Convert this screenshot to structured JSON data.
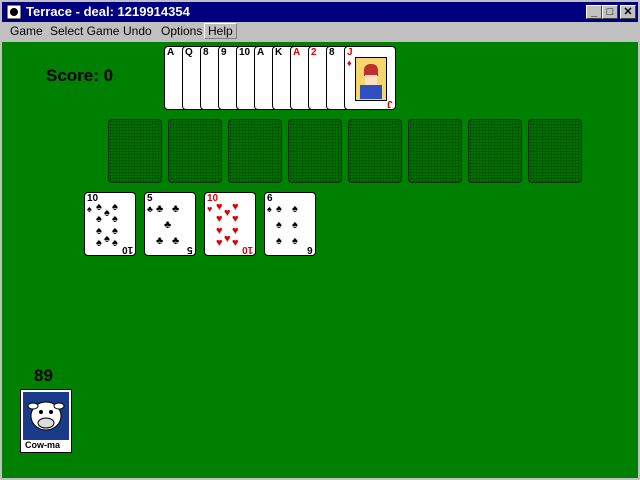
{
  "window": {
    "title": "Terrace - deal: 1219914354",
    "controls": {
      "minimize": "_",
      "maximize": "□",
      "close": "✕"
    }
  },
  "menu": {
    "items": [
      "Game",
      "Select Game",
      "Undo",
      "Options",
      "Help"
    ]
  },
  "game": {
    "score_text": "Score: 0",
    "stock_count": "89",
    "reserve_pile": [
      "A",
      "Q",
      "8",
      "9",
      "10",
      "A",
      "K",
      "A",
      "2",
      "8",
      "J"
    ],
    "reserve_top": {
      "rank": "J",
      "suit": "♦"
    },
    "foundation_slots": 8,
    "tableau": [
      {
        "rank": "10",
        "suit": "♠",
        "color": "black"
      },
      {
        "rank": "5",
        "suit": "♣",
        "color": "black"
      },
      {
        "rank": "10",
        "suit": "♥",
        "color": "red"
      },
      {
        "rank": "6",
        "suit": "♠",
        "color": "black"
      }
    ],
    "deck_label": "Cow-ma"
  },
  "colors": {
    "table": "#008000",
    "titlebar": "#000080",
    "red": "#e00000"
  }
}
